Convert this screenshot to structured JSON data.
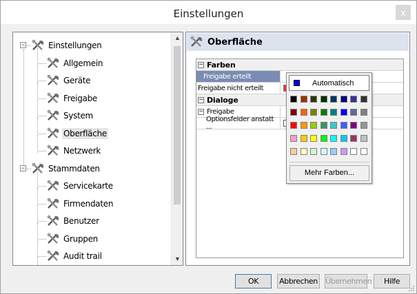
{
  "window": {
    "title": "Einstellungen",
    "close_label": "x"
  },
  "tree": {
    "items": [
      {
        "label": "Einstellungen",
        "level": 0,
        "expander": "−"
      },
      {
        "label": "Allgemein",
        "level": 1
      },
      {
        "label": "Geräte",
        "level": 1
      },
      {
        "label": "Freigabe",
        "level": 1
      },
      {
        "label": "System",
        "level": 1
      },
      {
        "label": "Oberfläche",
        "level": 1,
        "selected": true
      },
      {
        "label": "Netzwerk",
        "level": 1
      },
      {
        "label": "Stammdaten",
        "level": 0,
        "expander": "−"
      },
      {
        "label": "Servicekarte",
        "level": 1
      },
      {
        "label": "Firmendaten",
        "level": 1
      },
      {
        "label": "Benutzer",
        "level": 1
      },
      {
        "label": "Gruppen",
        "level": 1
      },
      {
        "label": "Audit trail",
        "level": 1
      }
    ],
    "scroll_up": "▲",
    "scroll_down": "▼"
  },
  "panel": {
    "header_title": "Oberfläche",
    "grid": {
      "cat1": {
        "label": "Farben",
        "expander": "⊟"
      },
      "row1": {
        "label": "Freigabe erteilt"
      },
      "row2": {
        "label": "Freigabe nicht erteilt",
        "color": "#ff3333"
      },
      "cat2": {
        "label": "Dialoge",
        "expander": "⊟"
      },
      "row3": {
        "label": "Freigabe",
        "expander": "⊟"
      },
      "row4": {
        "label": "Optionsfelder anstatt ..."
      }
    }
  },
  "color_popup": {
    "auto_label": "Automatisch",
    "auto_color": "#0000ff",
    "more_label": "Mehr Farben...",
    "colors": [
      [
        "#000000",
        "#993300",
        "#333300",
        "#003300",
        "#003366",
        "#000080",
        "#333399",
        "#333333"
      ],
      [
        "#800000",
        "#ff6600",
        "#808000",
        "#008000",
        "#008080",
        "#0000ff",
        "#666699",
        "#808080"
      ],
      [
        "#ff0000",
        "#ff9900",
        "#99cc00",
        "#339966",
        "#33cccc",
        "#3366ff",
        "#800080",
        "#969696"
      ],
      [
        "#ff99cc",
        "#ffcc00",
        "#ffff00",
        "#00ff00",
        "#00ffff",
        "#00ccff",
        "#993366",
        "#c0c0c0"
      ],
      [
        "#ffcc99",
        "#ffffcc",
        "#ccffcc",
        "#ccffff",
        "#99ccff",
        "#cc99ff",
        "#ffffff",
        "#ffffff"
      ]
    ]
  },
  "buttons": {
    "ok": "OK",
    "cancel": "Abbrechen",
    "apply": "Übernehmen",
    "help": "Hilfe"
  }
}
